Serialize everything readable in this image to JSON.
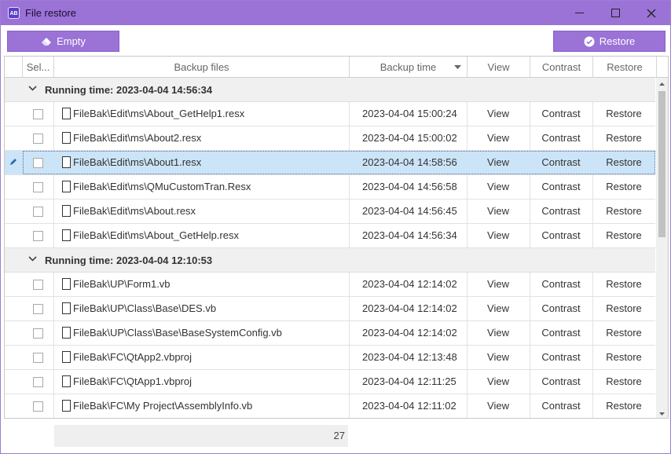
{
  "window": {
    "title": "File restore",
    "app_icon_text": "AB",
    "accent_color": "#9b72d6"
  },
  "toolbar": {
    "empty_label": "Empty",
    "empty_icon": "eraser-icon",
    "restore_label": "Restore",
    "restore_icon": "check-circle-icon"
  },
  "columns": {
    "select": "Sel...",
    "files": "Backup files",
    "time": "Backup time",
    "view": "View",
    "contrast": "Contrast",
    "restore": "Restore"
  },
  "groups": [
    {
      "label": "Running time: 2023-04-04 14:56:34",
      "rows": [
        {
          "file": "FileBak\\Edit\\ms\\About_GetHelp1.resx",
          "time": "2023-04-04 15:00:24",
          "view": "View",
          "contrast": "Contrast",
          "restore": "Restore"
        },
        {
          "file": "FileBak\\Edit\\ms\\About2.resx",
          "time": "2023-04-04 15:00:02",
          "view": "View",
          "contrast": "Contrast",
          "restore": "Restore"
        },
        {
          "file": "FileBak\\Edit\\ms\\About1.resx",
          "time": "2023-04-04 14:58:56",
          "view": "View",
          "contrast": "Contrast",
          "restore": "Restore"
        },
        {
          "file": "FileBak\\Edit\\ms\\QMuCustomTran.Resx",
          "time": "2023-04-04 14:56:58",
          "view": "View",
          "contrast": "Contrast",
          "restore": "Restore"
        },
        {
          "file": "FileBak\\Edit\\ms\\About.resx",
          "time": "2023-04-04 14:56:45",
          "view": "View",
          "contrast": "Contrast",
          "restore": "Restore"
        },
        {
          "file": "FileBak\\Edit\\ms\\About_GetHelp.resx",
          "time": "2023-04-04 14:56:34",
          "view": "View",
          "contrast": "Contrast",
          "restore": "Restore"
        }
      ]
    },
    {
      "label": "Running time: 2023-04-04 12:10:53",
      "rows": [
        {
          "file": "FileBak\\UP\\Form1.vb",
          "time": "2023-04-04 12:14:02",
          "view": "View",
          "contrast": "Contrast",
          "restore": "Restore"
        },
        {
          "file": "FileBak\\UP\\Class\\Base\\DES.vb",
          "time": "2023-04-04 12:14:02",
          "view": "View",
          "contrast": "Contrast",
          "restore": "Restore"
        },
        {
          "file": "FileBak\\UP\\Class\\Base\\BaseSystemConfig.vb",
          "time": "2023-04-04 12:14:02",
          "view": "View",
          "contrast": "Contrast",
          "restore": "Restore"
        },
        {
          "file": "FileBak\\FC\\QtApp2.vbproj",
          "time": "2023-04-04 12:13:48",
          "view": "View",
          "contrast": "Contrast",
          "restore": "Restore"
        },
        {
          "file": "FileBak\\FC\\QtApp1.vbproj",
          "time": "2023-04-04 12:11:25",
          "view": "View",
          "contrast": "Contrast",
          "restore": "Restore"
        },
        {
          "file": "FileBak\\FC\\My Project\\AssemblyInfo.vb",
          "time": "2023-04-04 12:11:02",
          "view": "View",
          "contrast": "Contrast",
          "restore": "Restore"
        }
      ]
    }
  ],
  "selected_row_color": "#cce4f7",
  "footer": {
    "count": "27"
  }
}
